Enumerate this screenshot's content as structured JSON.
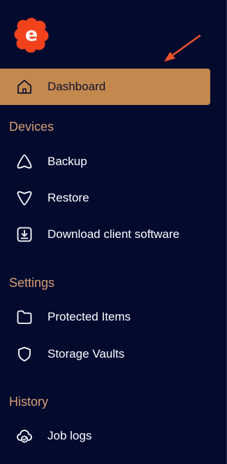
{
  "colors": {
    "background": "#020a2e",
    "accent": "#c3884d",
    "section_header": "#d89f73",
    "logo": "#f2421c",
    "arrow": "#e9542c"
  },
  "logo": {
    "letter": "e",
    "icon": "eazybackup-logo-icon"
  },
  "nav": {
    "dashboard": {
      "label": "Dashboard",
      "icon": "home-icon",
      "active": true
    },
    "sections": [
      {
        "title": "Devices",
        "items": [
          {
            "label": "Backup",
            "icon": "backup-icon"
          },
          {
            "label": "Restore",
            "icon": "restore-icon"
          },
          {
            "label": "Download client software",
            "icon": "download-icon"
          }
        ]
      },
      {
        "title": "Settings",
        "items": [
          {
            "label": "Protected Items",
            "icon": "folder-icon"
          },
          {
            "label": "Storage Vaults",
            "icon": "shield-icon"
          }
        ]
      },
      {
        "title": "History",
        "items": [
          {
            "label": "Job logs",
            "icon": "job-logs-icon"
          }
        ]
      }
    ]
  }
}
